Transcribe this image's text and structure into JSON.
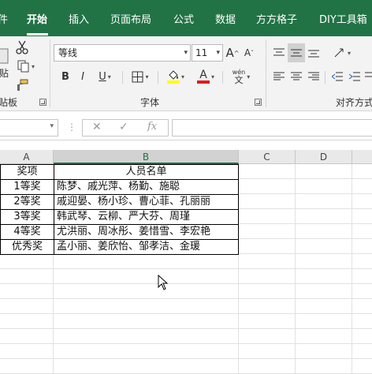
{
  "ribbon_tabs": [
    "件",
    "开始",
    "插入",
    "页面布局",
    "公式",
    "数据",
    "方方格子",
    "DIY工具箱"
  ],
  "active_tab": "开始",
  "clipboard": {
    "paste_fragment": "贴",
    "group_label": "贴板"
  },
  "font": {
    "name": "等线",
    "size": "11",
    "grow_label": "A",
    "shrink_label": "A",
    "bold": "B",
    "italic": "I",
    "underline": "U",
    "highlight_glyph": "A",
    "font_color_glyph": "A",
    "phonetic_top": "wén",
    "phonetic_bottom": "文",
    "group_label": "字体"
  },
  "alignment": {
    "group_label": "对齐方式"
  },
  "formula_bar": {
    "name_box": "",
    "cancel_glyph": "✕",
    "enter_glyph": "✓",
    "fx_glyph": "fx",
    "formula": ""
  },
  "columns": [
    "A",
    "B",
    "C",
    "D"
  ],
  "selected_column": "B",
  "sheet": {
    "header": {
      "award": "奖项",
      "names": "人员名单"
    },
    "rows": [
      {
        "award": "1等奖",
        "names": "陈梦、戚光萍、杨勤、施聪"
      },
      {
        "award": "2等奖",
        "names": "戚迎晏、杨小珍、曹心菲、孔丽丽"
      },
      {
        "award": "3等奖",
        "names": "韩武琴、云柳、严大芬、周瑾"
      },
      {
        "award": "4等奖",
        "names": "尤洪丽、周冰彤、姜惜雪、李宏艳"
      },
      {
        "award": "优秀奖",
        "names": "孟小丽、姜欣怡、邹孝洁、金瑗"
      }
    ]
  },
  "colors": {
    "excel_green": "#217346",
    "highlight_yellow": "#ffff00",
    "font_red": "#e11919"
  }
}
